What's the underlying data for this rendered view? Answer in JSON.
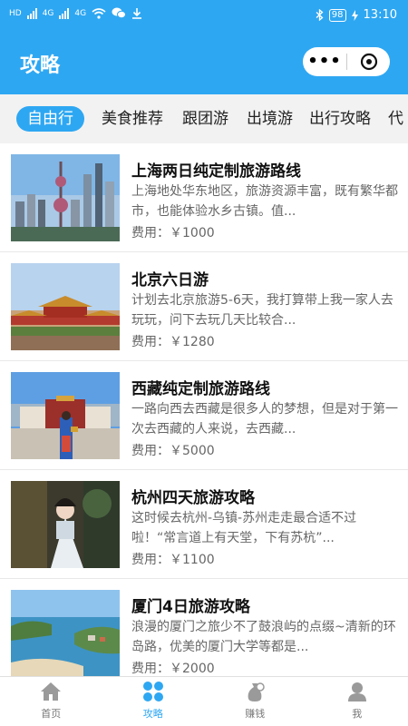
{
  "status_bar": {
    "left": [
      "HD",
      "4G",
      "4G"
    ],
    "battery": "98",
    "time": "13:10"
  },
  "nav": {
    "title": "攻略",
    "more_label": "•••"
  },
  "tabs": [
    {
      "label": "自由行",
      "active": true
    },
    {
      "label": "美食推荐",
      "active": false
    },
    {
      "label": "跟团游",
      "active": false
    },
    {
      "label": "出境游",
      "active": false
    },
    {
      "label": "出行攻略",
      "active": false
    },
    {
      "label": "代",
      "active": false
    }
  ],
  "items": [
    {
      "title": "上海两日纯定制旅游路线",
      "desc": "上海地处华东地区，旅游资源丰富，既有繁华都市，也能体验水乡古镇。值...",
      "cost": "费用：￥1000",
      "image": "shanghai-skyline"
    },
    {
      "title": "北京六日游",
      "desc": "计划去北京旅游5-6天，我打算带上我一家人去玩玩，问下去玩几天比较合...",
      "cost": "费用：￥1280",
      "image": "forbidden-city"
    },
    {
      "title": "西藏纯定制旅游路线",
      "desc": "一路向西去西藏是很多人的梦想，但是对于第一次去西藏的人来说，去西藏...",
      "cost": "费用：￥5000",
      "image": "potala-palace"
    },
    {
      "title": "杭州四天旅游攻略",
      "desc": "这时候去杭州-乌镇-苏州走走最合适不过啦！“常言道上有天堂，下有苏杭”...",
      "cost": "费用：￥1100",
      "image": "hangzhou-hanfu"
    },
    {
      "title": "厦门4日旅游攻略",
      "desc": "浪漫的厦门之旅少不了鼓浪屿的点缀~清新的环岛路，优美的厦门大学等都是...",
      "cost": "费用：￥2000",
      "image": "xiamen-coast"
    }
  ],
  "bottom_nav": [
    {
      "label": "首页",
      "icon": "home-icon",
      "active": false
    },
    {
      "label": "攻略",
      "icon": "grid-icon",
      "active": true
    },
    {
      "label": "赚钱",
      "icon": "money-bag-icon",
      "active": false
    },
    {
      "label": "我",
      "icon": "user-icon",
      "active": false
    }
  ],
  "colors": {
    "accent": "#2ea7f2"
  }
}
